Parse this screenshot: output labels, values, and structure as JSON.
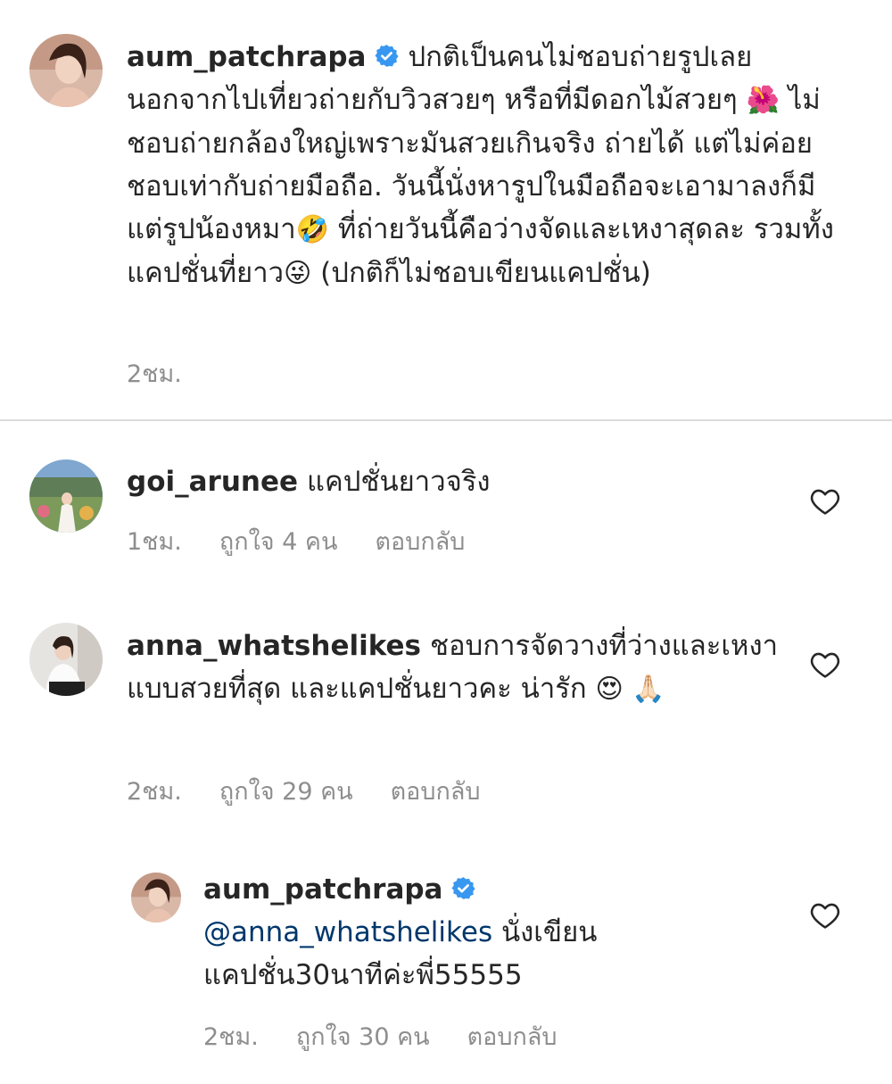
{
  "caption": {
    "username": "aum_patchrapa",
    "verified": true,
    "text_part1": "ปกติเป็นคนไม่ชอบถ่ายรูปเลย นอกจากไปเที่ยวถ่ายกับวิวสวยๆ หรือที่มีดอกไม้สวยๆ ",
    "emoji1": "🌺",
    "text_part2": " ไม่ชอบถ่ายกล้องใหญ่เพราะมันสวยเกินจริง ถ่ายได้ แต่ไม่ค่อยชอบเท่ากับถ่ายมือถือ.  วันนี้นั่งหารูปในมือถือจะเอามาลงก็มีแต่รูปน้องหมา",
    "emoji2": "🤣",
    "text_part3": " ที่ถ่ายวันนี้คือว่างจัดและเหงาสุดละ  รวมทั้งแคปชั่นที่ยาว",
    "emoji3": "😜",
    "text_part4": " (ปกติก็ไม่ชอบเขียนแคปชั่น)",
    "time": "2ชม."
  },
  "comments": [
    {
      "username": "goi_arunee",
      "text": "แคปชั่นยาวจริง",
      "time": "1ชม.",
      "likes": "ถูกใจ 4 คน",
      "reply_label": "ตอบกลับ"
    },
    {
      "username": "anna_whatshelikes",
      "text": "ชอบการจัดวางที่ว่างและเหงาแบบสวยที่สุด และแคปชั่นยาวคะ น่ารัก ",
      "emoji": "😍 🙏🏻",
      "time": "2ชม.",
      "likes": "ถูกใจ 29 คน",
      "reply_label": "ตอบกลับ"
    }
  ],
  "reply": {
    "username": "aum_patchrapa",
    "verified": true,
    "mention": "@anna_whatshelikes",
    "text": " นั่งเขียนแคปชั่น30นาทีค่ะพี่55555",
    "time": "2ชม.",
    "likes": "ถูกใจ 30 คน",
    "reply_label": "ตอบกลับ"
  },
  "colors": {
    "verified_badge": "#3897f0",
    "mention": "#00376b",
    "meta_text": "#8e8e8e",
    "divider": "#dbdbdb"
  }
}
